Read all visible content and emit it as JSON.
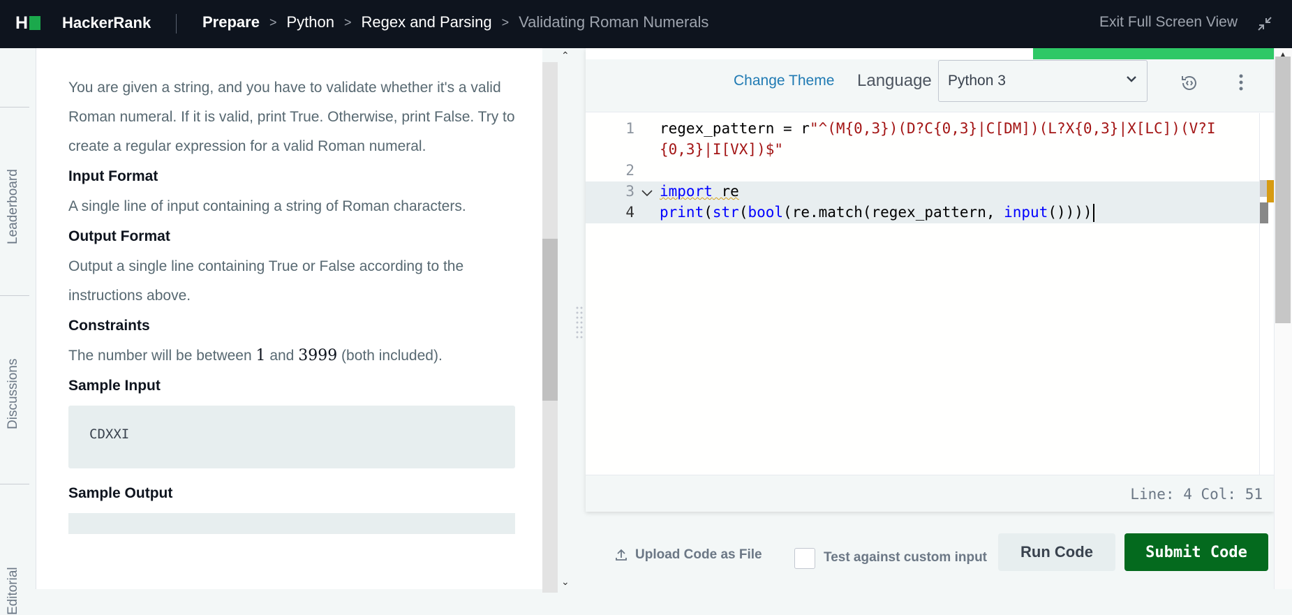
{
  "nav": {
    "brand": "HackerRank",
    "breadcrumbs": [
      "Prepare",
      "Python",
      "Regex and Parsing",
      "Validating Roman Numerals"
    ],
    "exit_label": "Exit Full Screen View"
  },
  "sidebar": {
    "tabs": [
      "Leaderboard",
      "Discussions",
      "Editorial"
    ]
  },
  "problem": {
    "intro": "You are given a string, and you have to validate whether it's a valid Roman numeral. If it is valid, print True. Otherwise, print False. Try to create a regular expression for a valid Roman numeral.",
    "input_format_title": "Input Format",
    "input_format_text": "A single line of input containing a string of Roman characters.",
    "output_format_title": "Output Format",
    "output_format_text": "Output a single line containing True or False according to the instructions above.",
    "constraints_title": "Constraints",
    "constraints_pre": "The number will be between ",
    "constraints_min": "1",
    "constraints_mid": " and ",
    "constraints_max": "3999",
    "constraints_post": " (both included).",
    "sample_input_title": "Sample Input",
    "sample_input": "CDXXI",
    "sample_output_title": "Sample Output"
  },
  "editor": {
    "change_theme": "Change Theme",
    "language_label": "Language",
    "language_value": "Python 3",
    "line_numbers": [
      "1",
      "2",
      "3",
      "4"
    ],
    "line1_var": "regex_pattern = r",
    "line1_str_a": "\"^(M{0,3})(D?C{0,3}|C[DM])(L?X{0,3}|X[LC])(V?I",
    "line1_str_b": "{0,3}|I[VX])$\"",
    "line3_kw": "import",
    "line3_rest": " re",
    "line4_print": "print",
    "line4_p1": "(",
    "line4_str": "str",
    "line4_p2": "(",
    "line4_bool": "bool",
    "line4_mid": "(re.match(regex_pattern, ",
    "line4_input": "input",
    "line4_end": "()))",
    "line4_last": ")",
    "cursor_position": "Line: 4 Col: 51"
  },
  "actions": {
    "upload_label": "Upload Code as File",
    "custom_input_label": "Test against custom input",
    "run_label": "Run Code",
    "submit_label": "Submit Code"
  },
  "colors": {
    "topbar": "#0e141e",
    "accent_green": "#1ba94c",
    "submit_green": "#046a1e",
    "link_blue": "#1f7ab3"
  }
}
